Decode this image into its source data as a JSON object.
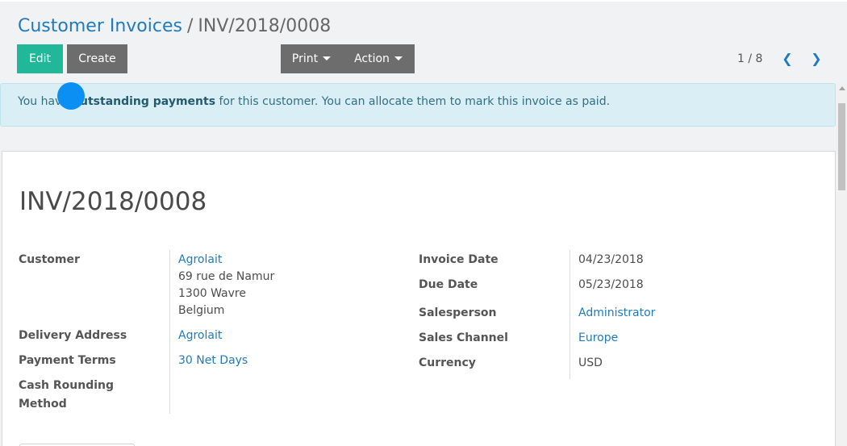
{
  "breadcrumb": {
    "parent": "Customer Invoices",
    "separator": "/",
    "current": "INV/2018/0008"
  },
  "toolbar": {
    "edit_label": "Edit",
    "create_label": "Create",
    "print_label": "Print",
    "action_label": "Action"
  },
  "pager": {
    "value": "1 / 8"
  },
  "alert": {
    "prefix": "You have ",
    "bold": "outstanding payments",
    "suffix": " for this customer. You can allocate them to mark this invoice as paid."
  },
  "invoice": {
    "title": "INV/2018/0008",
    "left_fields": {
      "customer_label": "Customer",
      "customer_name": "Agrolait",
      "address_line1": "69 rue de Namur",
      "address_line2": "1300 Wavre",
      "address_line3": "Belgium",
      "delivery_label": "Delivery Address",
      "delivery_value": "Agrolait",
      "payment_terms_label": "Payment Terms",
      "payment_terms_value": "30 Net Days",
      "cash_rounding_label_1": "Cash Rounding",
      "cash_rounding_label_2": "Method"
    },
    "right_fields": {
      "invoice_date_label": "Invoice Date",
      "invoice_date_value": "04/23/2018",
      "due_date_label": "Due Date",
      "due_date_value": "05/23/2018",
      "salesperson_label": "Salesperson",
      "salesperson_value": "Administrator",
      "sales_channel_label": "Sales Channel",
      "sales_channel_value": "Europe",
      "currency_label": "Currency",
      "currency_value": "USD"
    }
  },
  "colors": {
    "primary": "#21b799",
    "secondary": "#6d6d6d",
    "link": "#1f7bbf",
    "alert_bg": "#d9eff5"
  }
}
